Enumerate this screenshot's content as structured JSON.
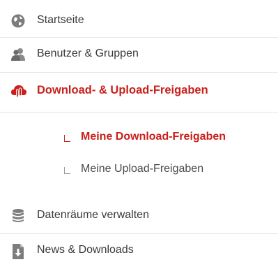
{
  "nav": {
    "items": [
      {
        "label": "Startseite",
        "icon": "globe-icon"
      },
      {
        "label": "Benutzer & Gruppen",
        "icon": "users-icon"
      },
      {
        "label": "Download- & Upload-Freigaben",
        "icon": "cloud-share-icon"
      },
      {
        "label": "Datenräume verwalten",
        "icon": "database-icon"
      },
      {
        "label": "News & Downloads",
        "icon": "file-download-icon"
      }
    ],
    "subitems": [
      {
        "label": "Meine Download-Freigaben"
      },
      {
        "label": "Meine Upload-Freigaben"
      }
    ]
  },
  "colors": {
    "accent": "#c9201b",
    "text": "#3a3a3a",
    "muted": "#6d6d6d"
  }
}
